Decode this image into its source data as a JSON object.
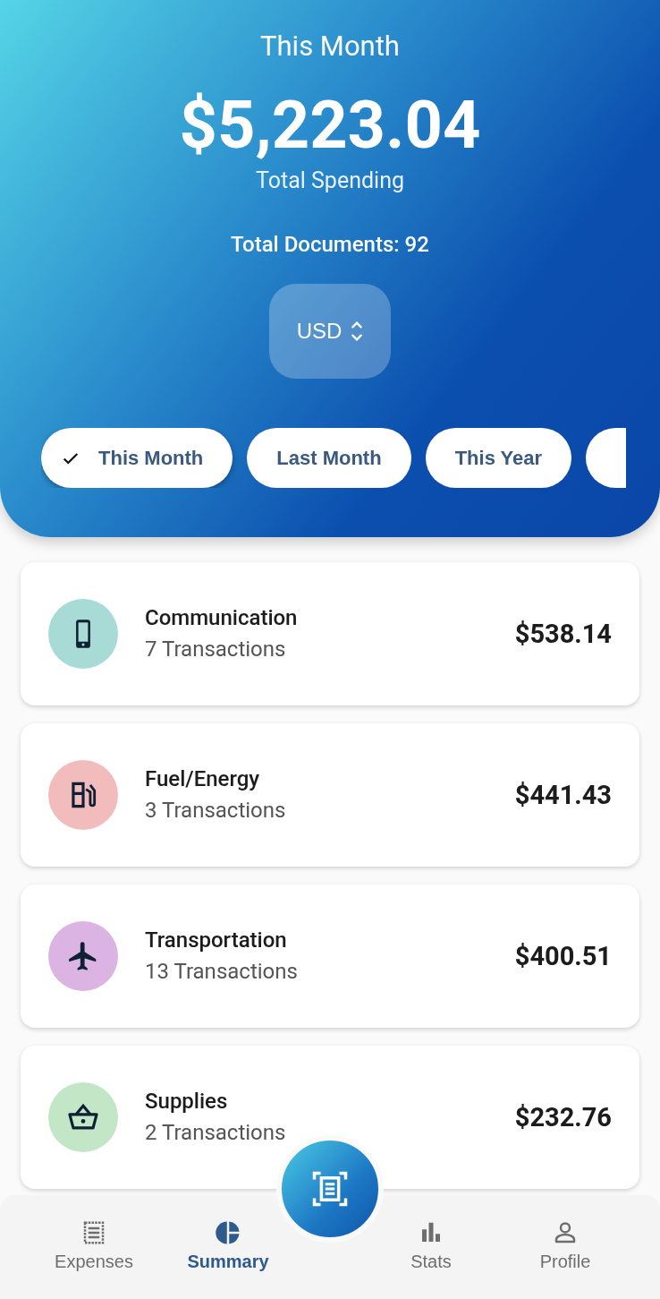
{
  "header": {
    "period_title": "This Month",
    "total_amount": "$5,223.04",
    "total_label": "Total Spending",
    "documents": "Total Documents: 92",
    "currency": "USD"
  },
  "period_chips": [
    {
      "label": "This Month",
      "selected": true
    },
    {
      "label": "Last Month",
      "selected": false
    },
    {
      "label": "This Year",
      "selected": false
    },
    {
      "selected": false
    }
  ],
  "categories": [
    {
      "kind": "phone",
      "color": "#a8dbd6",
      "name": "Communication",
      "count": "7 Transactions",
      "amount": "$538.14"
    },
    {
      "kind": "fuel",
      "color": "#f2bcbc",
      "name": "Fuel/Energy",
      "count": "3 Transactions",
      "amount": "$441.43"
    },
    {
      "kind": "plane",
      "color": "#dbb4e4",
      "name": "Transportation",
      "count": "13 Transactions",
      "amount": "$400.51"
    },
    {
      "kind": "basket",
      "color": "#c3e6c6",
      "name": "Supplies",
      "count": "2 Transactions",
      "amount": "$232.76"
    }
  ],
  "bottom_nav": [
    {
      "kind": "expenses",
      "label": "Expenses",
      "selected": false
    },
    {
      "kind": "summary",
      "label": "Summary",
      "selected": true
    },
    {
      "kind": "stats",
      "label": "Stats",
      "selected": false
    },
    {
      "kind": "profile",
      "label": "Profile",
      "selected": false
    }
  ]
}
